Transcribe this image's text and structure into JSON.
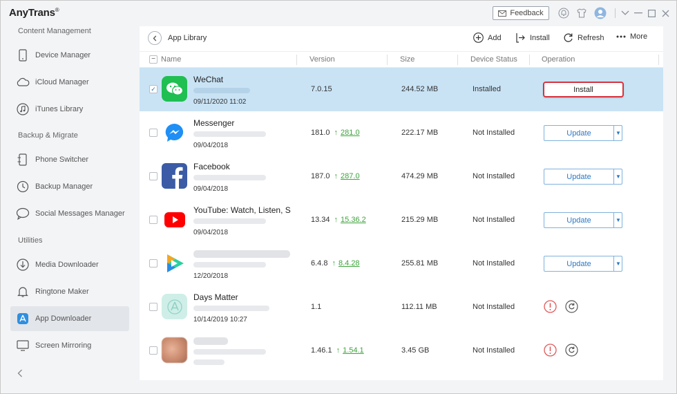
{
  "app": {
    "title": "AnyTrans",
    "reg_mark": "®"
  },
  "titlebar": {
    "feedback_label": "Feedback"
  },
  "sidebar": {
    "sections": [
      {
        "label": "Content Management"
      },
      {
        "label": "Backup & Migrate"
      },
      {
        "label": "Utilities"
      }
    ],
    "items": [
      {
        "label": "Device Manager",
        "icon": "phone-icon"
      },
      {
        "label": "iCloud Manager",
        "icon": "cloud-icon"
      },
      {
        "label": "iTunes Library",
        "icon": "music-note-icon"
      },
      {
        "label": "Phone Switcher",
        "icon": "phone-switch-icon"
      },
      {
        "label": "Backup Manager",
        "icon": "clock-icon"
      },
      {
        "label": "Social Messages Manager",
        "icon": "chat-icon"
      },
      {
        "label": "Media Downloader",
        "icon": "download-icon"
      },
      {
        "label": "Ringtone Maker",
        "icon": "bell-icon"
      },
      {
        "label": "App Downloader",
        "icon": "app-store-icon",
        "active": true
      },
      {
        "label": "Screen Mirroring",
        "icon": "screen-icon"
      }
    ]
  },
  "toolbar": {
    "breadcrumb": "App Library",
    "add_label": "Add",
    "install_label": "Install",
    "refresh_label": "Refresh",
    "more_label": "More"
  },
  "table": {
    "columns": [
      "Name",
      "Version",
      "Size",
      "Device Status",
      "Operation"
    ],
    "rows": [
      {
        "name": "WeChat",
        "date": "09/11/2020 11:02",
        "version": "7.0.15",
        "new_version": "",
        "size": "244.52 MB",
        "status": "Installed",
        "operation": "Install",
        "checked": true
      },
      {
        "name": "Messenger",
        "date": "09/04/2018",
        "version": "181.0",
        "new_version": "281.0",
        "size": "222.17 MB",
        "status": "Not Installed",
        "operation": "Update",
        "checked": false
      },
      {
        "name": "Facebook",
        "date": "09/04/2018",
        "version": "187.0",
        "new_version": "287.0",
        "size": "474.29 MB",
        "status": "Not Installed",
        "operation": "Update",
        "checked": false
      },
      {
        "name": "YouTube: Watch, Listen, S",
        "date": "09/04/2018",
        "version": "13.34",
        "new_version": "15.36.2",
        "size": "215.29 MB",
        "status": "Not Installed",
        "operation": "Update",
        "checked": false
      },
      {
        "name": "",
        "date": "12/20/2018",
        "version": "6.4.8",
        "new_version": "8.4.28",
        "size": "255.81 MB",
        "status": "Not Installed",
        "operation": "Update",
        "checked": false
      },
      {
        "name": "Days Matter",
        "date": "10/14/2019 10:27",
        "version": "1.1",
        "new_version": "",
        "size": "112.11 MB",
        "status": "Not Installed",
        "operation": "icons",
        "checked": false
      },
      {
        "name": "",
        "date": "",
        "version": "1.46.1",
        "new_version": "1.54.1",
        "size": "3.45 GB",
        "status": "Not Installed",
        "operation": "icons",
        "checked": false
      }
    ],
    "up_arrow": "↑"
  },
  "colors": {
    "selected_row": "#c9e3f5",
    "accent_blue": "#2a78c5",
    "install_border": "#d8323c",
    "update_green": "#3ea33c"
  }
}
